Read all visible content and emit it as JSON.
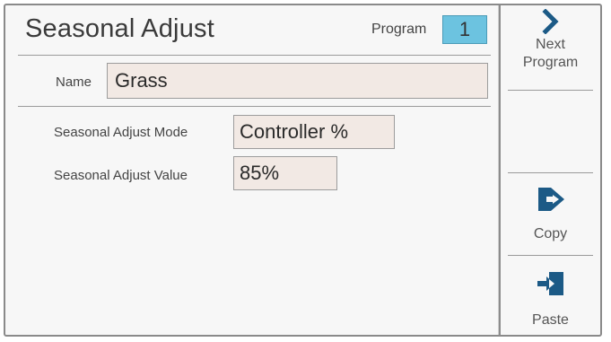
{
  "screen": {
    "title": "Seasonal Adjust",
    "program_label": "Program",
    "program_number": "1"
  },
  "name": {
    "label": "Name",
    "value": "Grass"
  },
  "seasonal_adjust_mode": {
    "label": "Seasonal Adjust Mode",
    "value": "Controller %"
  },
  "seasonal_adjust_value": {
    "label": "Seasonal Adjust Value",
    "value": "85%"
  },
  "side_buttons": {
    "next_program": {
      "line1": "Next",
      "line2": "Program",
      "icon": "chevron-right-icon"
    },
    "copy": {
      "label": "Copy",
      "icon": "copy-icon"
    },
    "paste": {
      "label": "Paste",
      "icon": "paste-icon"
    }
  },
  "colors": {
    "accent": "#6cc3e0",
    "icon": "#1c5a86",
    "field_bg": "#f2e9e4"
  }
}
